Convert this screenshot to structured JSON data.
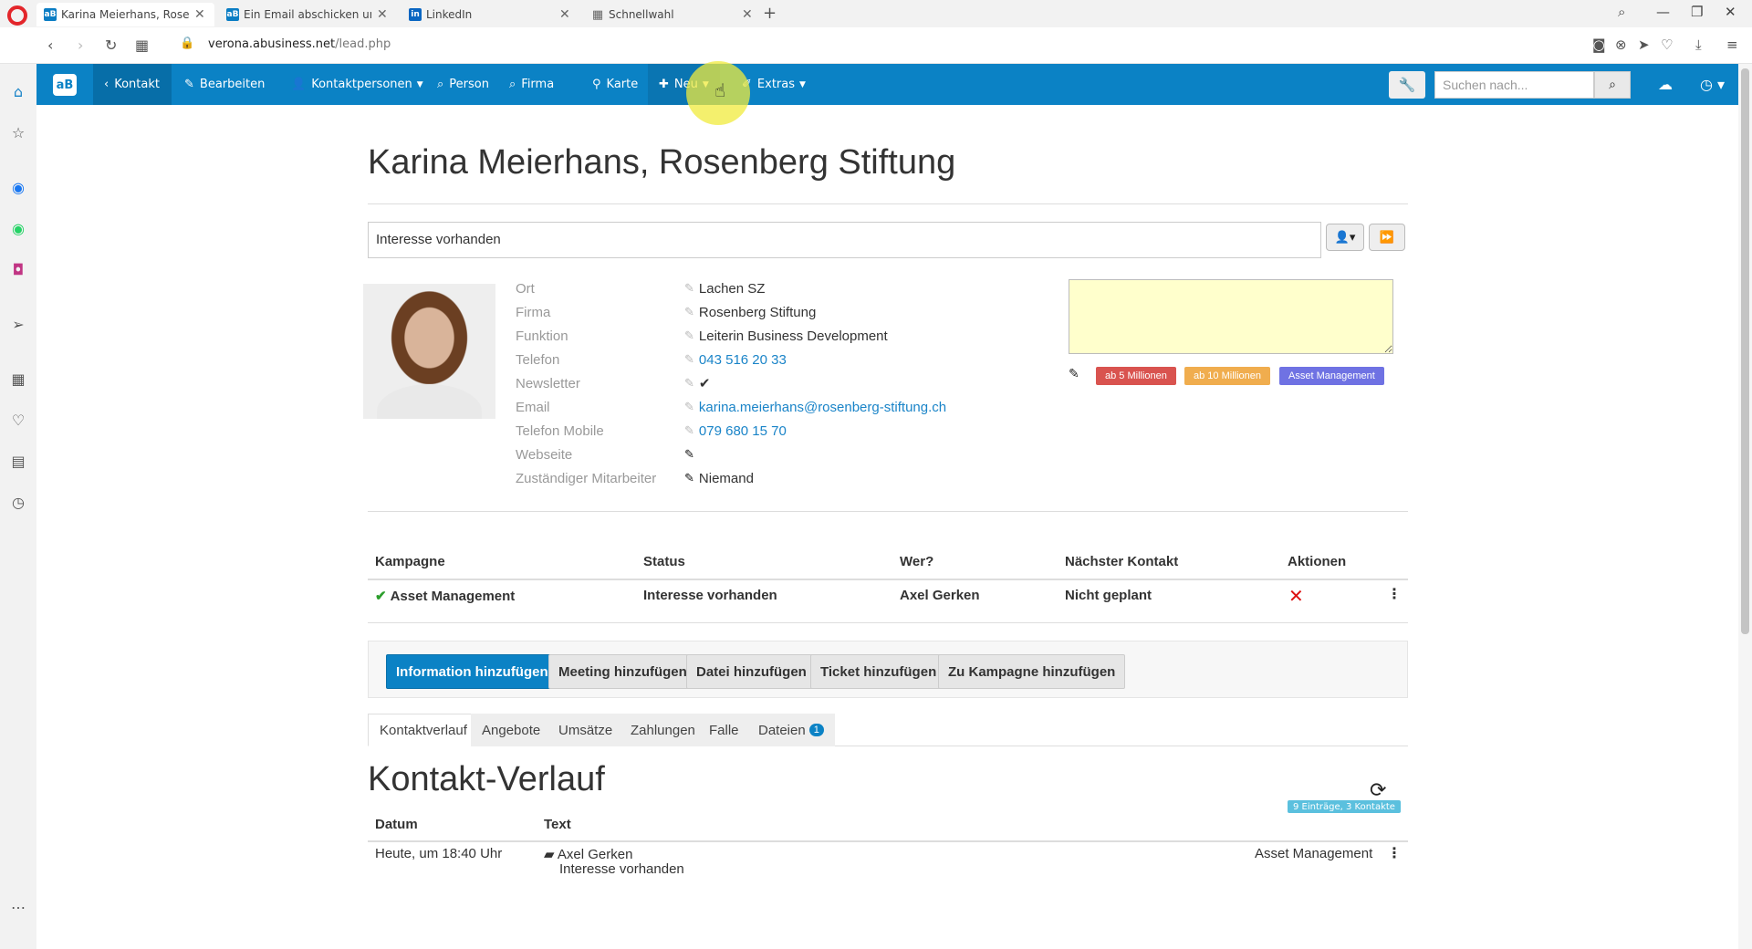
{
  "browser": {
    "tabs": [
      {
        "label": "Karina Meierhans, Rosenbe",
        "active": true
      },
      {
        "label": "Ein Email abschicken und d",
        "active": false
      },
      {
        "label": "LinkedIn",
        "active": false
      },
      {
        "label": "Schnellwahl",
        "active": false
      }
    ],
    "url_host": "verona.abusiness.net",
    "url_path": "/lead.php"
  },
  "navbar": {
    "brand": "aB",
    "items": {
      "kontakt": "Kontakt",
      "bearbeiten": "Bearbeiten",
      "kontaktpersonen": "Kontaktpersonen",
      "person": "Person",
      "firma": "Firma",
      "karte": "Karte",
      "neu": "Neu",
      "extras": "Extras"
    },
    "search_placeholder": "Suchen nach..."
  },
  "lead": {
    "title": "Karina Meierhans, Rosenberg Stiftung",
    "status": "Interesse vorhanden",
    "fields": [
      {
        "label": "Ort",
        "value": "Lachen SZ"
      },
      {
        "label": "Firma",
        "value": "Rosenberg Stiftung"
      },
      {
        "label": "Funktion",
        "value": "Leiterin Business Development"
      },
      {
        "label": "Telefon",
        "value": "043 516 20 33"
      },
      {
        "label": "Newsletter",
        "value": "✔"
      },
      {
        "label": "Email",
        "value": "karina.meierhans@rosenberg-stiftung.ch"
      },
      {
        "label": "Telefon Mobile",
        "value": "079 680 15 70"
      },
      {
        "label": "Webseite",
        "value": ""
      },
      {
        "label": "Zuständiger Mitarbeiter",
        "value": "Niemand"
      }
    ],
    "tags": [
      {
        "label": "ab 5 Millionen",
        "color": "#d9534f"
      },
      {
        "label": "ab 10 Millionen",
        "color": "#f0ad4e"
      },
      {
        "label": "Asset Management",
        "color": "#6f72e3"
      }
    ]
  },
  "campaigns": {
    "headers": [
      "Kampagne",
      "Status",
      "Wer?",
      "Nächster Kontakt",
      "Aktionen"
    ],
    "rows": [
      {
        "kampagne": "Asset Management",
        "status": "Interesse vorhanden",
        "wer": "Axel Gerken",
        "naechster": "Nicht geplant"
      }
    ]
  },
  "actions": {
    "information": "Information hinzufügen",
    "meeting": "Meeting hinzufügen",
    "datei": "Datei hinzufügen",
    "ticket": "Ticket hinzufügen",
    "kampagne": "Zu Kampagne hinzufügen"
  },
  "tabs": {
    "kontaktverlauf": "Kontaktverlauf",
    "angebote": "Angebote",
    "umsaetze": "Umsätze",
    "zahlungen": "Zahlungen",
    "falle": "Falle",
    "dateien": "Dateien",
    "dateien_count": "1"
  },
  "history": {
    "title": "Kontakt-Verlauf",
    "count_badge": "9 Einträge, 3 Kontakte",
    "headers": [
      "Datum",
      "Text"
    ],
    "rows": [
      {
        "datum": "Heute, um 18:40 Uhr",
        "author": "Axel Gerken",
        "text": "Interesse vorhanden",
        "campaign": "Asset Management"
      }
    ]
  },
  "colors": {
    "primary": "#0b82c5",
    "note_bg": "#ffffcc"
  }
}
